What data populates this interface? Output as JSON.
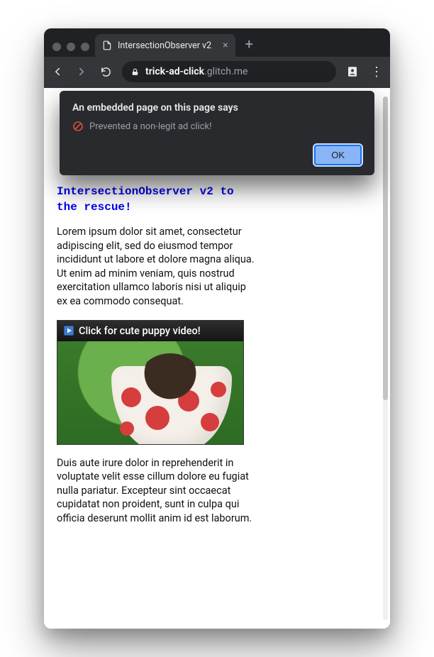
{
  "browser": {
    "tab_title": "IntersectionObserver v2",
    "url_host": "trick-ad-click",
    "url_path": ".glitch.me",
    "new_tab_glyph": "+",
    "close_tab_glyph": "×",
    "menu_glyph": "⋮"
  },
  "alert": {
    "header": "An embedded page on this page says",
    "message": "Prevented a non-legit ad click!",
    "ok_label": "OK"
  },
  "page": {
    "headline_html": "IntersectionObserver v2 to the rescue!",
    "para1": "Lorem ipsum dolor sit amet, consectetur adipiscing elit, sed do eiusmod tempor incididunt ut labore et dolore magna aliqua. Ut enim ad minim veniam, quis nostrud exercitation ullamco laboris nisi ut aliquip ex ea commodo consequat.",
    "video_caption": "Click for cute puppy video!",
    "para2": "Duis aute irure dolor in reprehenderit in voluptate velit esse cillum dolore eu fugiat nulla pariatur. Excepteur sint occaecat cupidatat non proident, sunt in culpa qui officia deserunt mollit anim id est laborum."
  }
}
